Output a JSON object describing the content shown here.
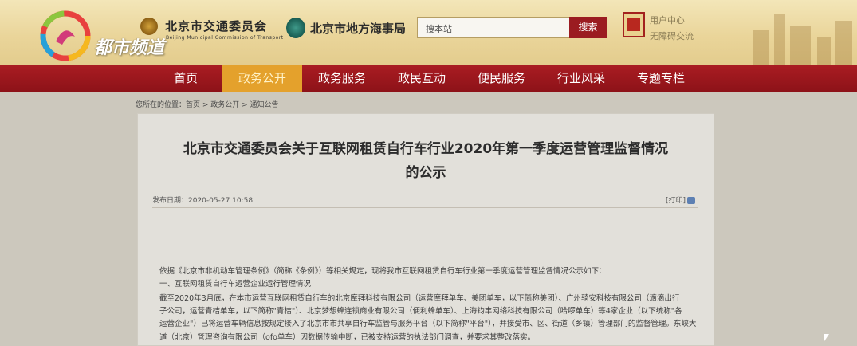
{
  "channel": {
    "name": "都市频道"
  },
  "header": {
    "org1_name": "北京市交通委员会",
    "org1_en": "Beijing Municipal Commission of Transport",
    "org2_name": "北京市地方海事局",
    "search_placeholder": "搜本站",
    "search_button": "搜索",
    "user_center": "用户中心",
    "barrier_free": "无障碍交流"
  },
  "nav": {
    "items": [
      {
        "label": "首页"
      },
      {
        "label": "政务公开"
      },
      {
        "label": "政务服务"
      },
      {
        "label": "政民互动"
      },
      {
        "label": "便民服务"
      },
      {
        "label": "行业风采"
      },
      {
        "label": "专题专栏"
      }
    ],
    "active_index": 1
  },
  "breadcrumb": "您所在的位置：首页 > 政务公开 > 通知公告",
  "article": {
    "title_line1": "北京市交通委员会关于互联网租赁自行车行业2020年第一季度运营管理监督情况",
    "title_line2": "的公示",
    "publish_time": "发布日期：2020-05-27 10:58",
    "print_label": "[打印]",
    "paragraphs": [
      "依据《北京市非机动车管理条例》（简称《条例》）等相关规定，现将我市互联网租赁自行车行业第一季度运营管理监督情况公示如下：",
      "一、互联网租赁自行车运营企业运行管理情况",
      "截至2020年3月底，在本市运营互联网租赁自行车的北京摩拜科技有限公司（运营摩拜单车、美团单车，以下简称美团）、广州骑安科技有限公司（滴滴出行",
      "子公司，运营青桔单车，以下简称\"青桔\"）、北京梦想蜂连锁商业有限公司（便利蜂单车）、上海钧丰网络科技有限公司（哈啰单车）等4家企业（以下统称\"各",
      "运营企业\"）已将运营车辆信息按规定接入了北京市市共享自行车监管与服务平台（以下简称\"平台\"），并接受市、区、街道（乡镇）管理部门的监督管理。东峡大",
      "道（北京）管理咨询有限公司（ofo单车）因数据传输中断，已被支持运营的执法部门调查，并要求其整改落实。"
    ]
  }
}
